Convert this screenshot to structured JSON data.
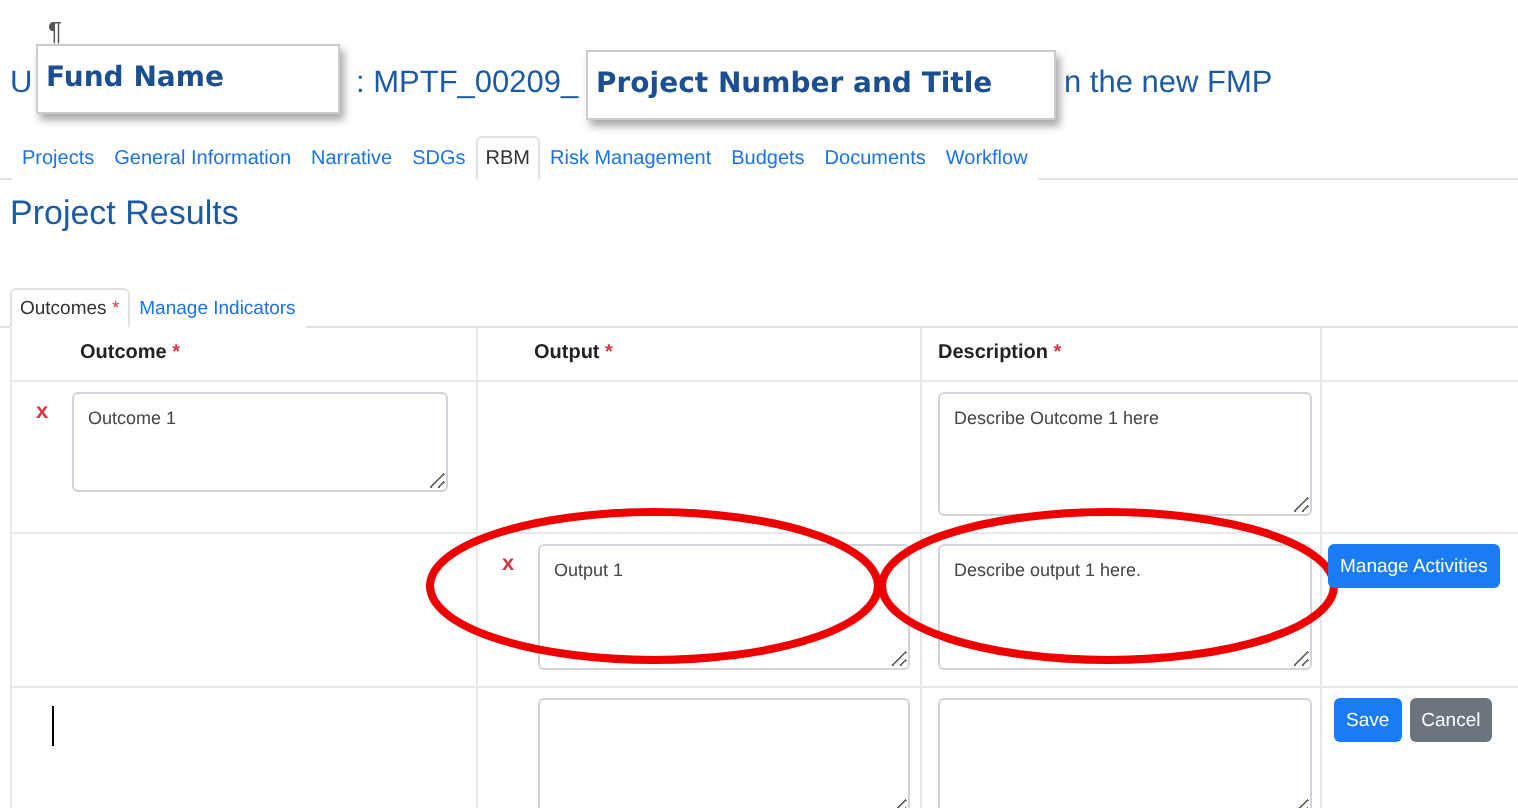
{
  "pilcrow": "¶",
  "title": {
    "parts": [
      "U",
      ": MPTF_00209_",
      "n the new FMP"
    ]
  },
  "callouts": [
    {
      "label": "Fund Name"
    },
    {
      "label": "Project Number and Title"
    }
  ],
  "nav_tabs": [
    {
      "label": "Projects",
      "selected": false
    },
    {
      "label": "General Information",
      "selected": false
    },
    {
      "label": "Narrative",
      "selected": false
    },
    {
      "label": "SDGs",
      "selected": false
    },
    {
      "label": "RBM",
      "selected": true
    },
    {
      "label": "Risk Management",
      "selected": false
    },
    {
      "label": "Budgets",
      "selected": false
    },
    {
      "label": "Documents",
      "selected": false
    },
    {
      "label": "Workflow",
      "selected": false
    }
  ],
  "section_title": "Project Results",
  "sub_tabs": [
    {
      "label": "Outcomes",
      "required_mark": "*",
      "selected": true
    },
    {
      "label": "Manage Indicators",
      "selected": false
    }
  ],
  "table": {
    "columns": [
      {
        "label": "Outcome",
        "required_mark": "*"
      },
      {
        "label": "Output",
        "required_mark": "*"
      },
      {
        "label": "Description",
        "required_mark": "*"
      }
    ],
    "rows": [
      {
        "kind": "outcome",
        "delete": "x",
        "outcome": "Outcome 1",
        "description": "Describe Outcome 1 here"
      },
      {
        "kind": "output",
        "delete": "x",
        "output": "Output 1",
        "description": "Describe output 1 here.",
        "button": "Manage Activities",
        "output_circled": true,
        "description_circled": true
      },
      {
        "kind": "new",
        "buttons": [
          "Save",
          "Cancel"
        ]
      }
    ]
  }
}
